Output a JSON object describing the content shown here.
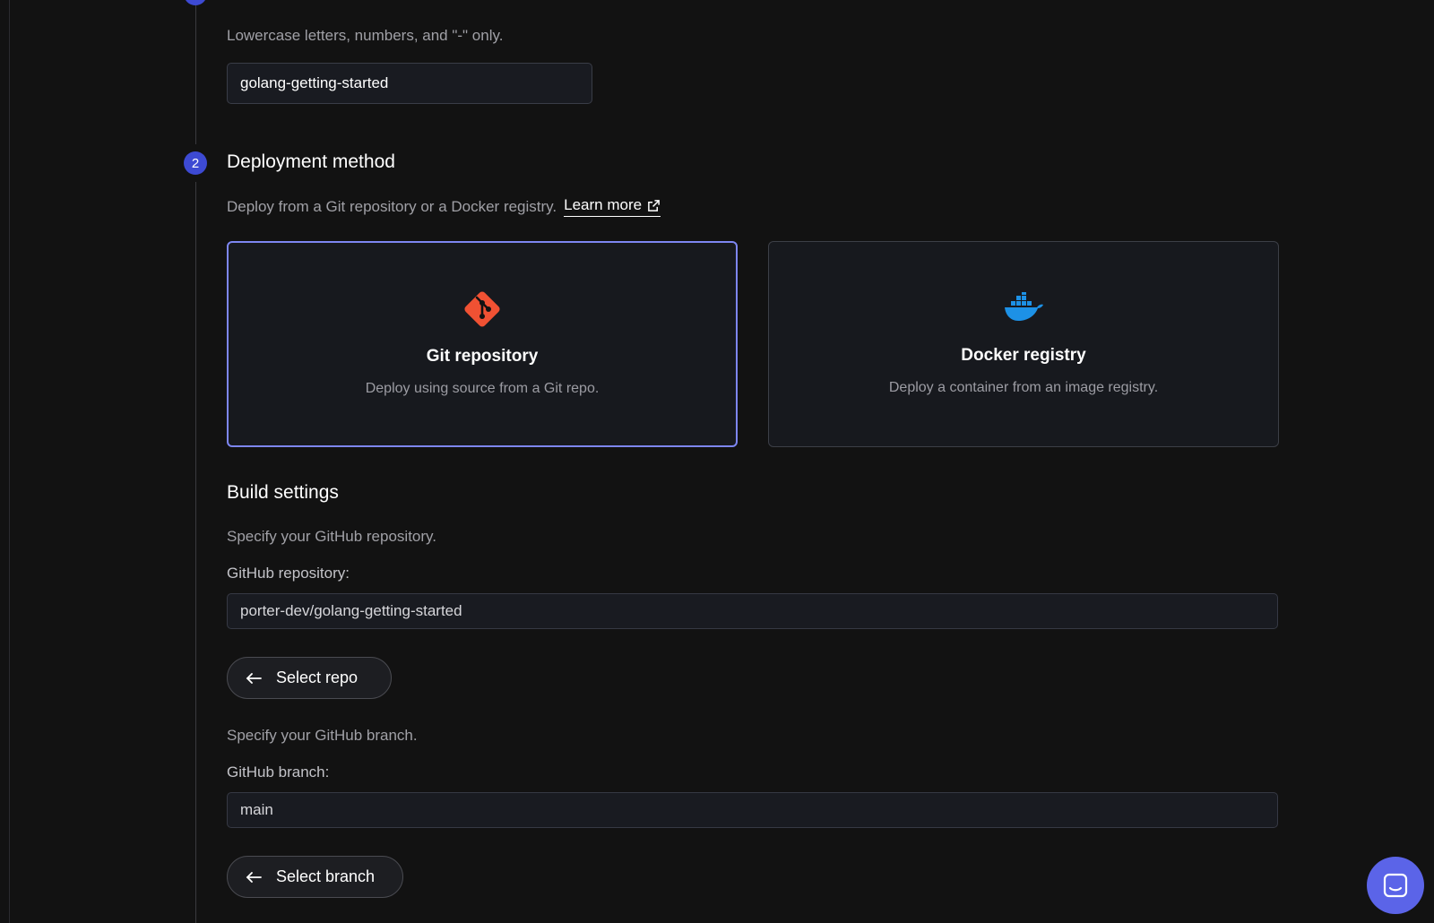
{
  "app_name": {
    "hint": "Lowercase letters, numbers, and \"-\" only.",
    "value": "golang-getting-started"
  },
  "deployment": {
    "step_number": "2",
    "title": "Deployment method",
    "description": "Deploy from a Git repository or a Docker registry.",
    "learn_more": "Learn more",
    "options": [
      {
        "title": "Git repository",
        "description": "Deploy using source from a Git repo.",
        "icon": "git-icon",
        "selected": true
      },
      {
        "title": "Docker registry",
        "description": "Deploy a container from an image registry.",
        "icon": "docker-icon",
        "selected": false
      }
    ]
  },
  "build": {
    "title": "Build settings",
    "repo_hint": "Specify your GitHub repository.",
    "repo_label": "GitHub repository:",
    "repo_value": "porter-dev/golang-getting-started",
    "select_repo": "Select repo",
    "branch_hint": "Specify your GitHub branch.",
    "branch_label": "GitHub branch:",
    "branch_value": "main",
    "select_branch": "Select branch"
  },
  "colors": {
    "accent": "#7d86f2",
    "step_badge": "#3d4ad3",
    "git": "#f05133",
    "docker": "#1d91e6",
    "chat": "#5b64e8"
  }
}
